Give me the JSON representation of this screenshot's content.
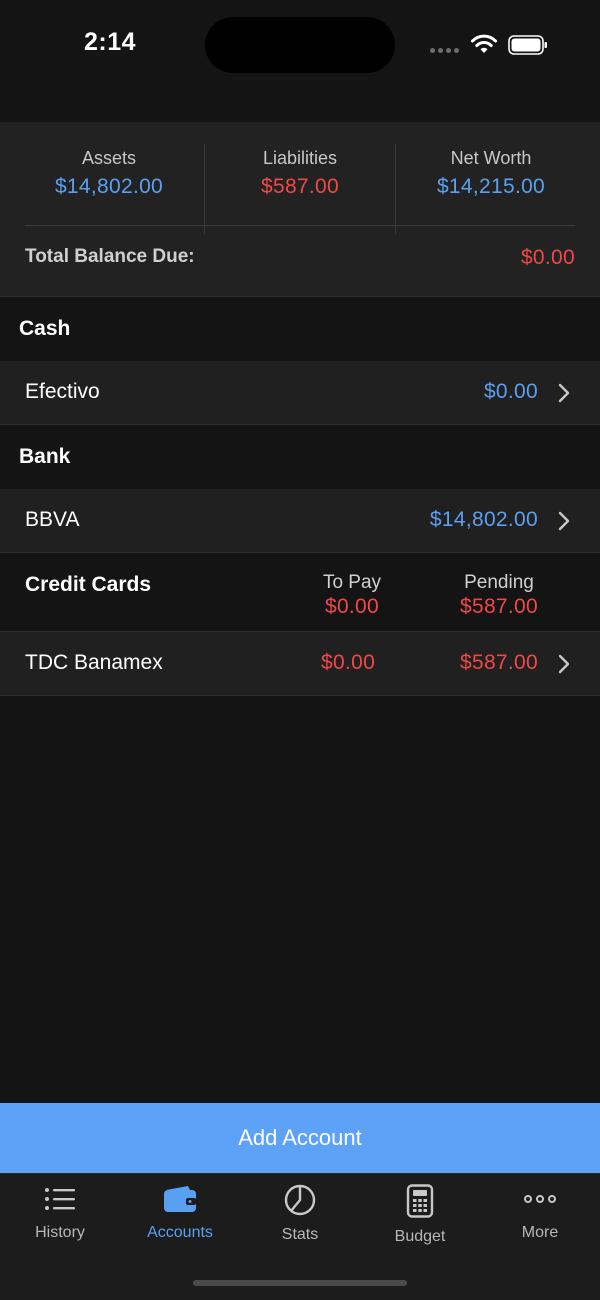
{
  "status_bar": {
    "time": "2:14",
    "icons": [
      "cellular-dots-icon",
      "wifi-icon",
      "battery-icon"
    ]
  },
  "summary": {
    "assets_label": "Assets",
    "assets_value": "$14,802.00",
    "liabilities_label": "Liabilities",
    "liabilities_value": "$587.00",
    "net_worth_label": "Net Worth",
    "net_worth_value": "$14,215.00",
    "total_balance_due_label": "Total Balance Due:",
    "total_balance_due_value": "$0.00"
  },
  "sections": {
    "cash": {
      "title": "Cash",
      "accounts": [
        {
          "name": "Efectivo",
          "amount": "$0.00"
        }
      ]
    },
    "bank": {
      "title": "Bank",
      "accounts": [
        {
          "name": "BBVA",
          "amount": "$14,802.00"
        }
      ]
    },
    "credit_cards": {
      "title": "Credit Cards",
      "to_pay_label": "To Pay",
      "to_pay_total": "$0.00",
      "pending_label": "Pending",
      "pending_total": "$587.00",
      "accounts": [
        {
          "name": "TDC Banamex",
          "to_pay": "$0.00",
          "pending": "$587.00"
        }
      ]
    }
  },
  "add_account_label": "Add Account",
  "tabs": [
    {
      "label": "History",
      "icon": "list-icon",
      "active": false
    },
    {
      "label": "Accounts",
      "icon": "wallet-icon",
      "active": true
    },
    {
      "label": "Stats",
      "icon": "pie-chart-icon",
      "active": false
    },
    {
      "label": "Budget",
      "icon": "calculator-icon",
      "active": false
    },
    {
      "label": "More",
      "icon": "more-dots-icon",
      "active": false
    }
  ],
  "colors": {
    "positive": "#5aa0f0",
    "negative": "#f04848",
    "accent_button": "#5ea2f7",
    "background": "#141414",
    "row_background": "#202020"
  }
}
